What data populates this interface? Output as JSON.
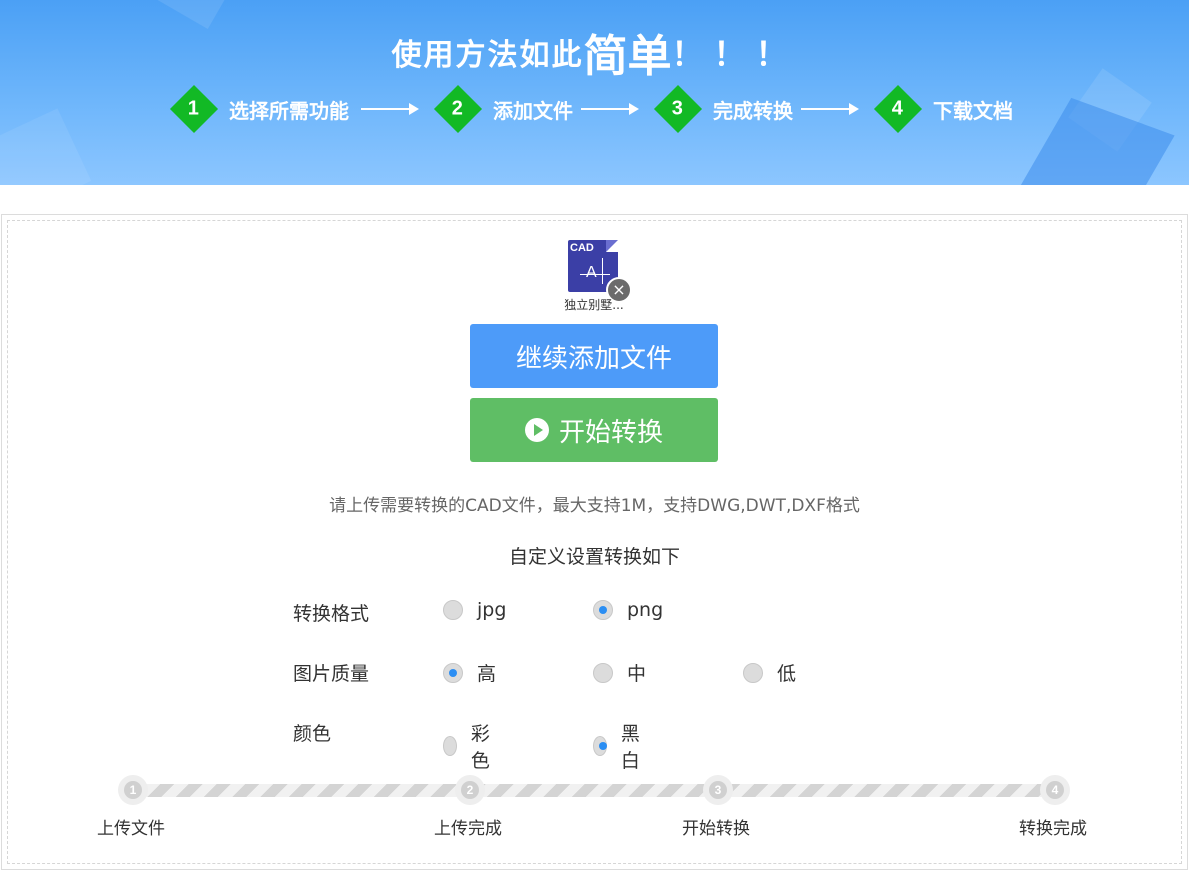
{
  "banner": {
    "title_part1": "使用方法如此",
    "title_part2": "简单",
    "title_part3": "！！！",
    "steps": [
      {
        "num": "1",
        "label": "选择所需功能"
      },
      {
        "num": "2",
        "label": "添加文件"
      },
      {
        "num": "3",
        "label": "完成转换"
      },
      {
        "num": "4",
        "label": "下载文档"
      }
    ],
    "step_color": "#12b925"
  },
  "file": {
    "icon_text": "CAD",
    "icon_glyph": "A",
    "name": "独立别墅...",
    "remove_icon": "×"
  },
  "buttons": {
    "add_more": "继续添加文件",
    "start": "开始转换"
  },
  "hint": "请上传需要转换的CAD文件，最大支持1M，支持DWG,DWT,DXF格式",
  "settings": {
    "title": "自定义设置转换如下",
    "format": {
      "label": "转换格式",
      "options": [
        "jpg",
        "png"
      ],
      "selected": "png"
    },
    "quality": {
      "label": "图片质量",
      "options": [
        "高",
        "中",
        "低"
      ],
      "selected": "高"
    },
    "color": {
      "label": "颜色",
      "options": [
        "彩色",
        "黑白"
      ],
      "selected": "黑白"
    }
  },
  "progress": {
    "steps": [
      {
        "num": "1",
        "label": "上传文件"
      },
      {
        "num": "2",
        "label": "上传完成"
      },
      {
        "num": "3",
        "label": "开始转换"
      },
      {
        "num": "4",
        "label": "转换完成"
      }
    ]
  },
  "colors": {
    "primary_blue": "#4d9bf9",
    "start_green": "#5fbe65",
    "radio_selected": "#2b8ef3"
  }
}
